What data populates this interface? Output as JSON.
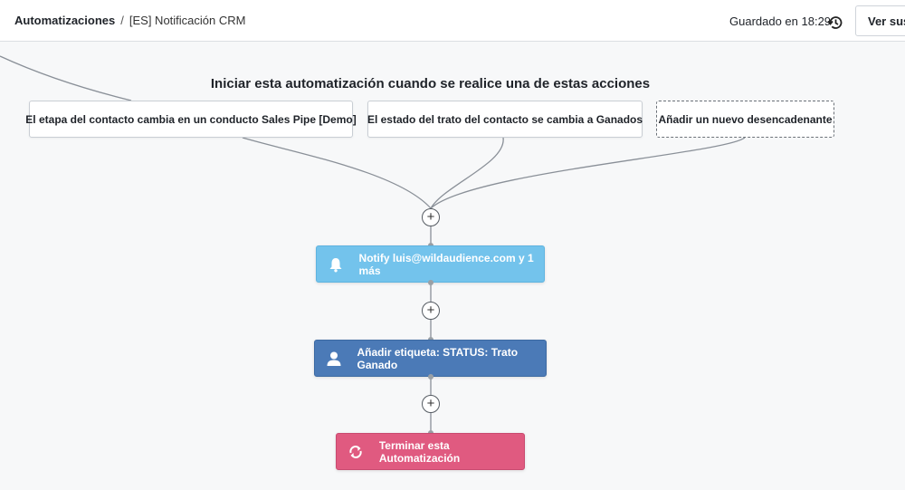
{
  "header": {
    "breadcrumb_root": "Automatizaciones",
    "breadcrumb_sep": "/",
    "breadcrumb_current": "[ES] Notificación CRM",
    "saved_status": "Guardado en 18:29",
    "view_button": "Ver suscriptores"
  },
  "workflow": {
    "heading": "Iniciar esta automatización cuando se realice una de estas acciones",
    "triggers": [
      {
        "label": "El etapa del contacto cambia en un conducto Sales Pipe [Demo]"
      },
      {
        "label": "El estado del trato del contacto se cambia a Ganados"
      },
      {
        "label": "Añadir un nuevo desencadenante"
      }
    ],
    "plus_symbol": "+",
    "steps": [
      {
        "label": "Notify luis@wildaudience.com y 1 más",
        "icon": "bell-icon",
        "color": "#73c3ec"
      },
      {
        "label": "Añadir etiqueta: STATUS: Trato Ganado",
        "icon": "user-icon",
        "color": "#4b7ab7"
      },
      {
        "label": "Terminar esta Automatización",
        "icon": "refresh-icon",
        "color": "#e05a80"
      }
    ]
  },
  "colors": {
    "connector": "#8a9098",
    "canvas_bg": "#f7f8f9"
  }
}
